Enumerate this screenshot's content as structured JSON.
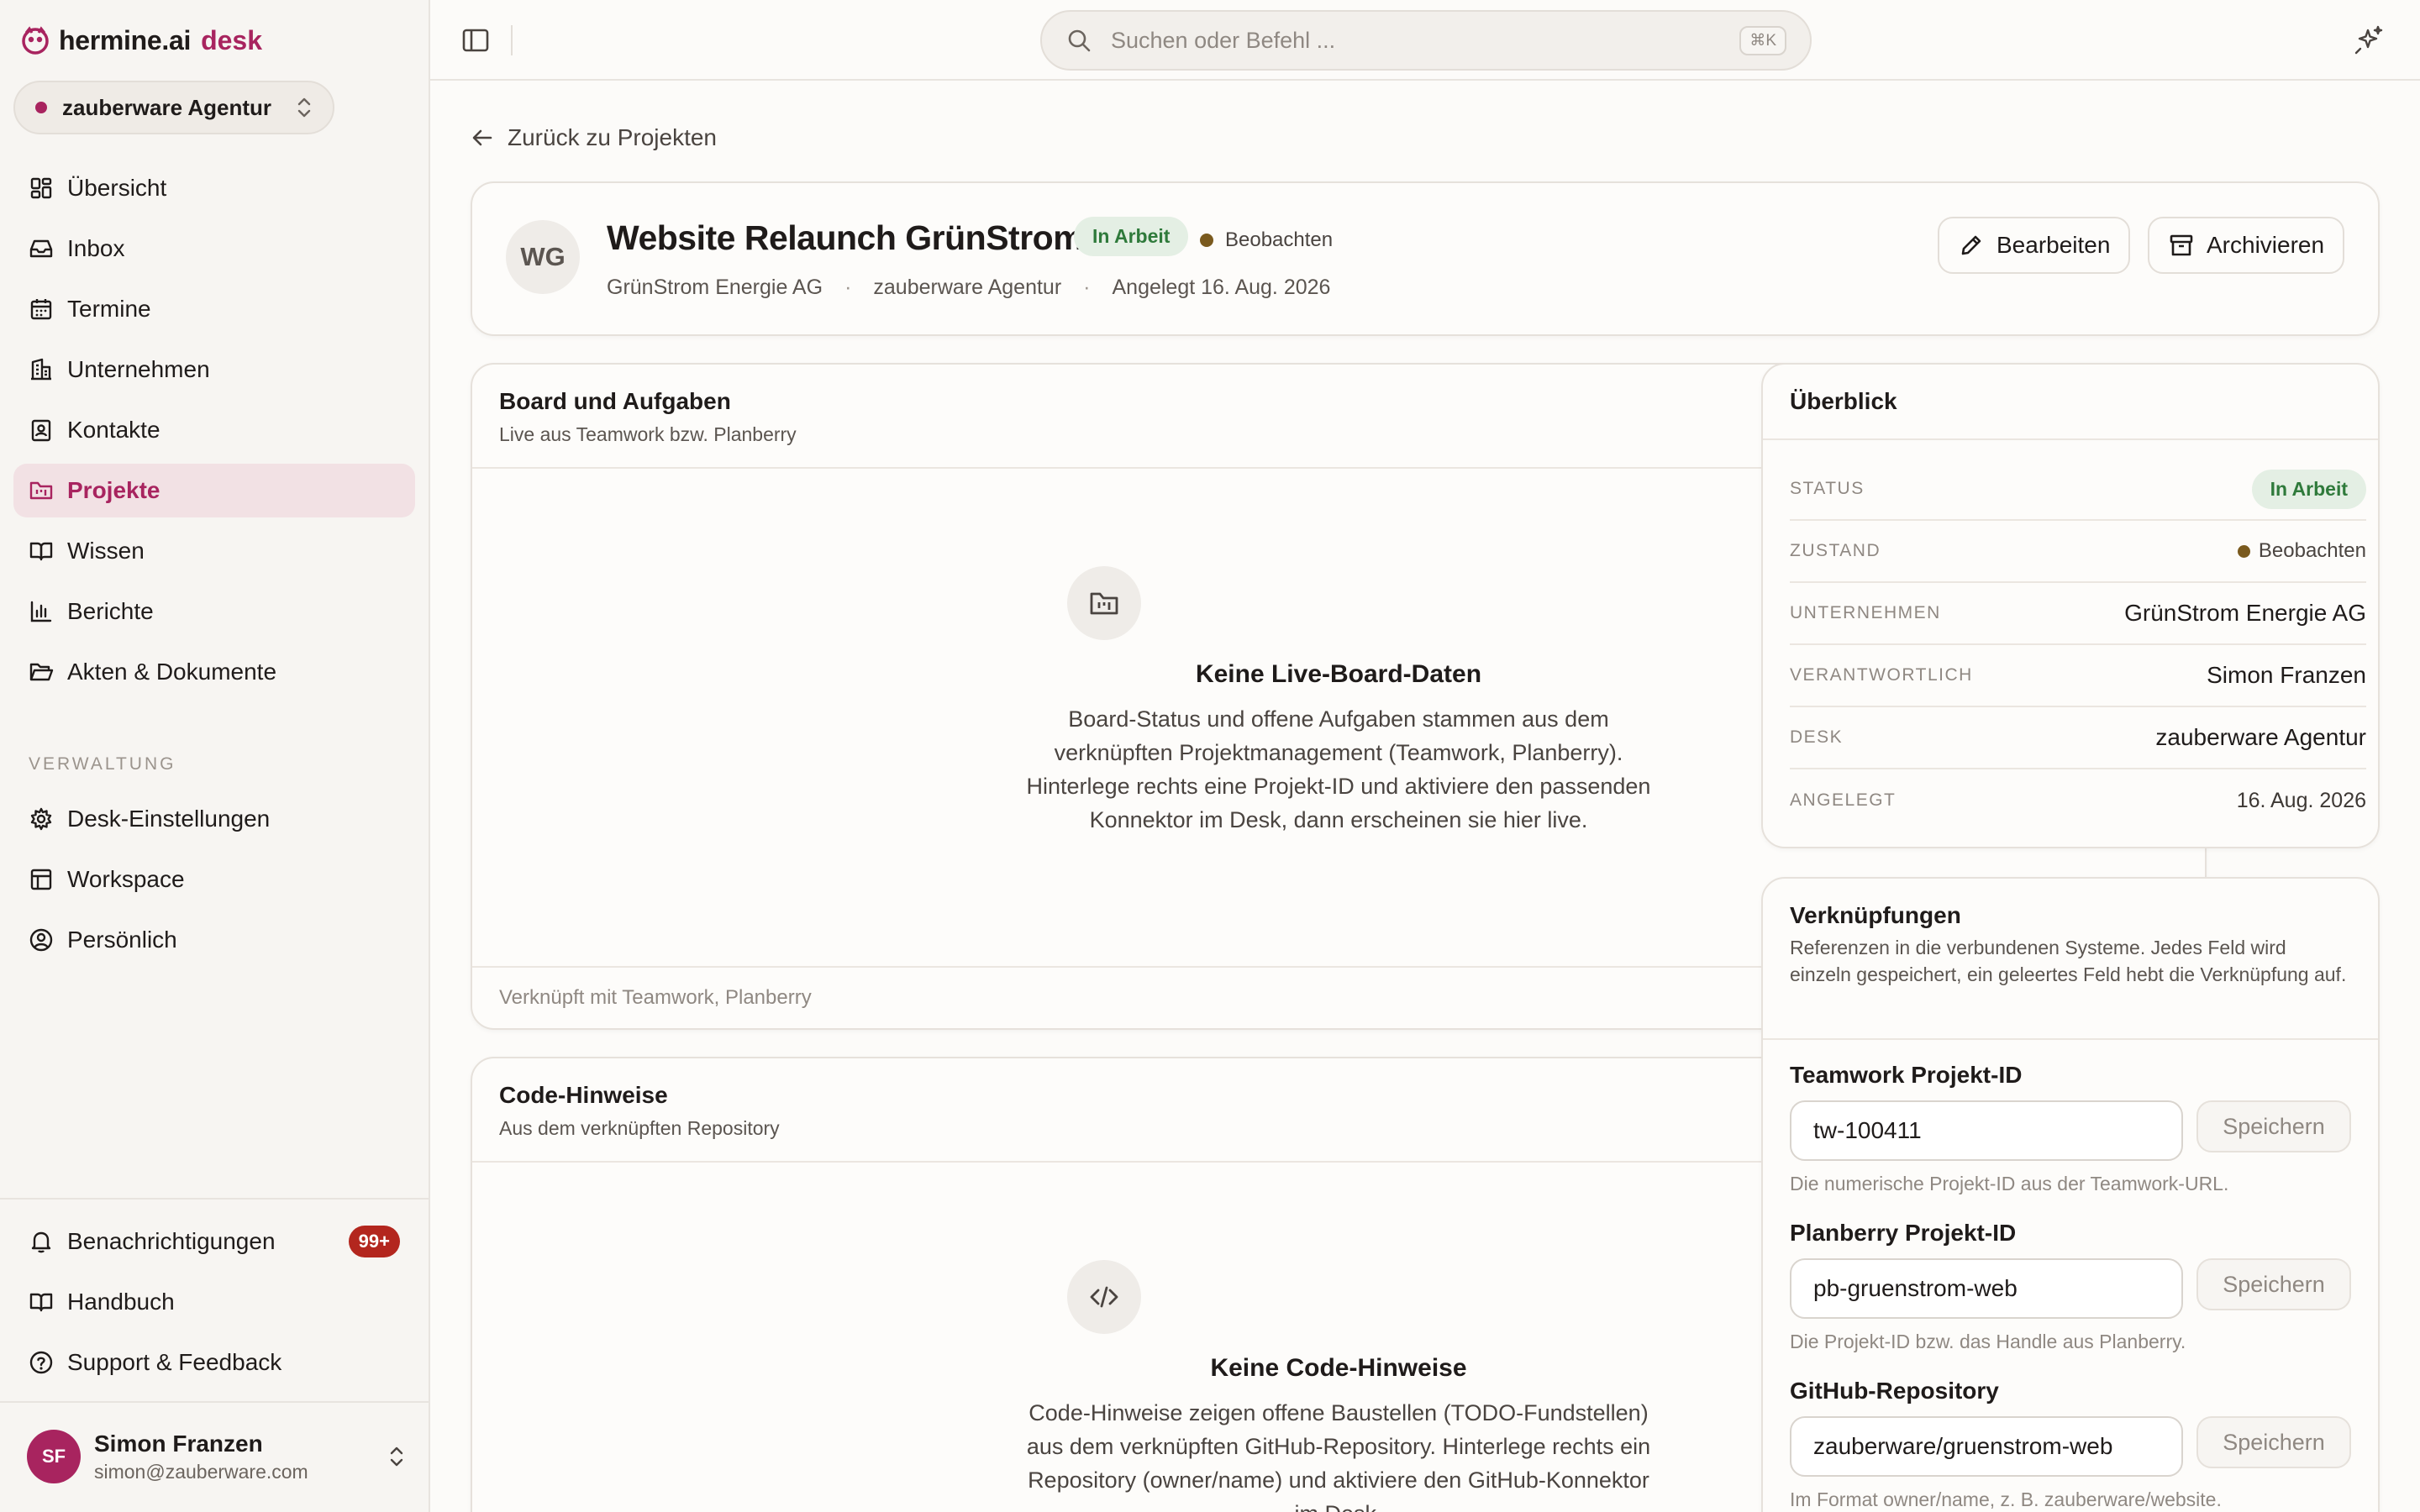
{
  "brand": {
    "name": "hermine.ai",
    "product": "desk"
  },
  "desk_switcher": {
    "label": "zauberware Agentur"
  },
  "nav": {
    "main": [
      {
        "label": "Übersicht",
        "icon": "dashboard-icon"
      },
      {
        "label": "Inbox",
        "icon": "inbox-icon"
      },
      {
        "label": "Termine",
        "icon": "calendar-icon"
      },
      {
        "label": "Unternehmen",
        "icon": "building-icon"
      },
      {
        "label": "Kontakte",
        "icon": "contact-icon"
      },
      {
        "label": "Projekte",
        "icon": "folder-kanban-icon",
        "active": true
      },
      {
        "label": "Wissen",
        "icon": "book-open-icon"
      },
      {
        "label": "Berichte",
        "icon": "bar-chart-icon"
      },
      {
        "label": "Akten & Dokumente",
        "icon": "folder-open-icon"
      }
    ],
    "section_label": "VERWALTUNG",
    "admin": [
      {
        "label": "Desk-Einstellungen",
        "icon": "gear-icon"
      },
      {
        "label": "Workspace",
        "icon": "layout-icon"
      },
      {
        "label": "Persönlich",
        "icon": "user-circle-icon"
      }
    ],
    "bottom": [
      {
        "label": "Benachrichtigungen",
        "icon": "bell-icon",
        "badge": "99+"
      },
      {
        "label": "Handbuch",
        "icon": "book-icon"
      },
      {
        "label": "Support & Feedback",
        "icon": "help-circle-icon"
      }
    ]
  },
  "user": {
    "initials": "SF",
    "name": "Simon Franzen",
    "email": "simon@zauberware.com"
  },
  "topbar": {
    "search_placeholder": "Suchen oder Befehl ...",
    "shortcut": "⌘K"
  },
  "back_link": "Zurück zu Projekten",
  "project": {
    "initials": "WG",
    "title": "Website Relaunch GrünStrom",
    "status": "In Arbeit",
    "state": "Beobachten",
    "company": "GrünStrom Energie AG",
    "desk": "zauberware Agentur",
    "created": "Angelegt 16. Aug. 2026",
    "edit_label": "Bearbeiten",
    "archive_label": "Archivieren"
  },
  "board": {
    "title": "Board und Aufgaben",
    "subtitle": "Live aus Teamwork bzw. Planberry",
    "empty_title": "Keine Live-Board-Daten",
    "empty_text": "Board-Status und offene Aufgaben stammen aus dem verknüpften Projektmanagement (Teamwork, Planberry). Hinterlege rechts eine Projekt-ID und aktiviere den passenden Konnektor im Desk, dann erscheinen sie hier live.",
    "footer": "Verknüpft mit Teamwork, Planberry"
  },
  "code": {
    "title": "Code-Hinweise",
    "subtitle": "Aus dem verknüpften Repository",
    "empty_title": "Keine Code-Hinweise",
    "empty_text": "Code-Hinweise zeigen offene Baustellen (TODO-Fundstellen) aus dem verknüpften GitHub-Repository. Hinterlege rechts ein Repository (owner/name) und aktiviere den GitHub-Konnektor im Desk."
  },
  "overview": {
    "title": "Überblick",
    "rows": [
      {
        "key": "STATUS",
        "value": "In Arbeit"
      },
      {
        "key": "ZUSTAND",
        "value": "Beobachten"
      },
      {
        "key": "UNTERNEHMEN",
        "value": "GrünStrom Energie AG"
      },
      {
        "key": "VERANTWORTLICH",
        "value": "Simon Franzen"
      },
      {
        "key": "DESK",
        "value": "zauberware Agentur"
      },
      {
        "key": "ANGELEGT",
        "value": "16. Aug. 2026"
      }
    ]
  },
  "links": {
    "title": "Verknüpfungen",
    "subtitle": "Referenzen in die verbundenen Systeme. Jedes Feld wird einzeln gespeichert, ein geleertes Feld hebt die Verknüpfung auf.",
    "save_label": "Speichern",
    "fields": [
      {
        "label": "Teamwork Projekt-ID",
        "value": "tw-100411",
        "help": "Die numerische Projekt-ID aus der Teamwork-URL."
      },
      {
        "label": "Planberry Projekt-ID",
        "value": "pb-gruenstrom-web",
        "help": "Die Projekt-ID bzw. das Handle aus Planberry."
      },
      {
        "label": "GitHub-Repository",
        "value": "zauberware/gruenstrom-web",
        "help": "Im Format owner/name, z. B. zauberware/website."
      }
    ]
  },
  "colors": {
    "accent": "#a8245f",
    "status_green": "#2f7a3b",
    "state_dot": "#7a5a1e",
    "badge_red": "#b3261e"
  }
}
